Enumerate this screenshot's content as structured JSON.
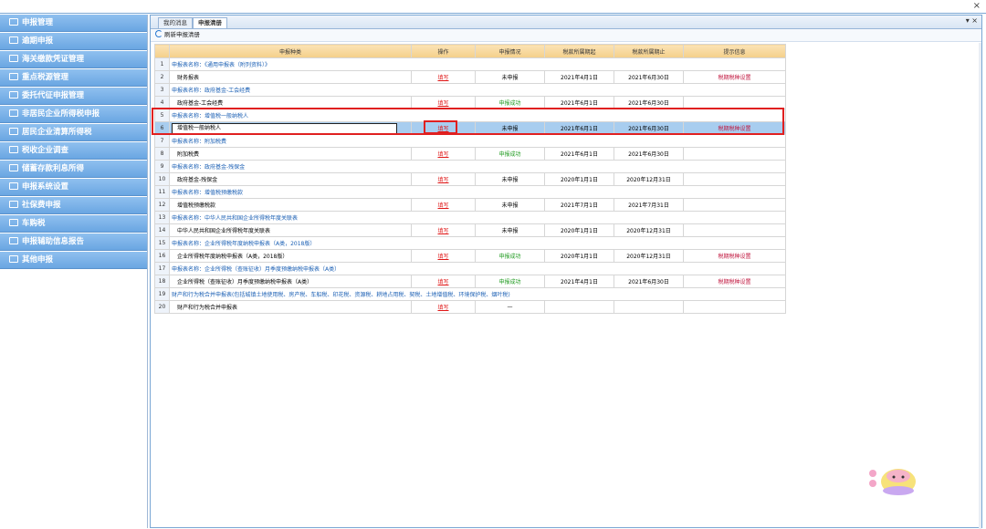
{
  "window": {
    "close_glyph": "×"
  },
  "sidebar": {
    "items": [
      {
        "label": "申报管理"
      },
      {
        "label": "逾期申报"
      },
      {
        "label": "海关缴款凭证管理"
      },
      {
        "label": "重点税源管理"
      },
      {
        "label": "委托代征申报管理"
      },
      {
        "label": "非居民企业所得税申报"
      },
      {
        "label": "居民企业清算所得税"
      },
      {
        "label": "税收企业调查"
      },
      {
        "label": "储蓄存款利息所得"
      },
      {
        "label": "申报系统设置"
      },
      {
        "label": "社保费申报"
      },
      {
        "label": "车购税"
      },
      {
        "label": "申报辅助信息报告"
      },
      {
        "label": "其他申报"
      }
    ]
  },
  "tabs": [
    {
      "label": "我的消息"
    },
    {
      "label": "申报清册"
    }
  ],
  "tab_controls": "▾ ×",
  "toolbar": {
    "refresh_label": "刷新申报清册"
  },
  "table": {
    "headers": [
      "申报种类",
      "操作",
      "申报情况",
      "税款所属期起",
      "税款所属期止",
      "提示信息"
    ],
    "rows": [
      {
        "n": "1",
        "group": "申报表名称：《通用申报表（附列资料）》"
      },
      {
        "n": "2",
        "name": "财务报表",
        "op": "填写",
        "status": "未申报",
        "start": "2021年4月1日",
        "end": "2021年6月30日",
        "tip": "税期税种设置",
        "status_class": ""
      },
      {
        "n": "3",
        "group": "申报表名称：政府基金-工会经费"
      },
      {
        "n": "4",
        "name": "政府基金-工会经费",
        "op": "填写",
        "status": "申报成功",
        "start": "2021年6月1日",
        "end": "2021年6月30日",
        "tip": "",
        "status_class": "green"
      },
      {
        "n": "5",
        "group": "申报表名称：增值税一般纳税人"
      },
      {
        "n": "6",
        "name": "增值税一般纳税人",
        "op": "填写",
        "status": "未申报",
        "start": "2021年6月1日",
        "end": "2021年6月30日",
        "tip": "税期税种设置",
        "status_class": "",
        "selected": true
      },
      {
        "n": "7",
        "group": "申报表名称：附加税费"
      },
      {
        "n": "8",
        "name": "附加税费",
        "op": "填写",
        "status": "申报成功",
        "start": "2021年6月1日",
        "end": "2021年6月30日",
        "tip": "",
        "status_class": "green"
      },
      {
        "n": "9",
        "group": "申报表名称：政府基金-残保金"
      },
      {
        "n": "10",
        "name": "政府基金-残保金",
        "op": "填写",
        "status": "未申报",
        "start": "2020年1月1日",
        "end": "2020年12月31日",
        "tip": "",
        "status_class": ""
      },
      {
        "n": "11",
        "group": "申报表名称：增值税预缴税款"
      },
      {
        "n": "12",
        "name": "增值税预缴税款",
        "op": "填写",
        "status": "未申报",
        "start": "2021年7月1日",
        "end": "2021年7月31日",
        "tip": "",
        "status_class": ""
      },
      {
        "n": "13",
        "group": "申报表名称：中华人民共和国企业所得税年度关联表"
      },
      {
        "n": "14",
        "name": "中华人民共和国企业所得税年度关联表",
        "op": "填写",
        "status": "未申报",
        "start": "2020年1月1日",
        "end": "2020年12月31日",
        "tip": "",
        "status_class": ""
      },
      {
        "n": "15",
        "group": "申报表名称：企业所得税年度纳税申报表（A类，2018版）"
      },
      {
        "n": "16",
        "name": "企业所得税年度纳税申报表（A类，2018版）",
        "op": "填写",
        "status": "申报成功",
        "start": "2020年1月1日",
        "end": "2020年12月31日",
        "tip": "税期税种设置",
        "status_class": "green"
      },
      {
        "n": "17",
        "group": "申报表名称：企业所得税（查账征收）月季度预缴纳税申报表（A类）"
      },
      {
        "n": "18",
        "name": "企业所得税（查账征收）月季度预缴纳税申报表（A类）",
        "op": "填写",
        "status": "申报成功",
        "start": "2021年4月1日",
        "end": "2021年6月30日",
        "tip": "税期税种设置",
        "status_class": "green"
      },
      {
        "n": "19",
        "group": "财产和行为税合并申报表(包括城镇土地使用税、房产税、车船税、印花税、资源税、耕地占用税、契税、土地增值税、环境保护税、烟叶税)"
      },
      {
        "n": "20",
        "name": "财产和行为税合并申报表",
        "op": "填写",
        "status": "—",
        "start": "",
        "end": "",
        "tip": "",
        "status_class": ""
      }
    ]
  },
  "colors": {
    "accent": "#6aa6e2",
    "highlight_frame": "#e02020",
    "selected_row": "#a8cdef"
  }
}
